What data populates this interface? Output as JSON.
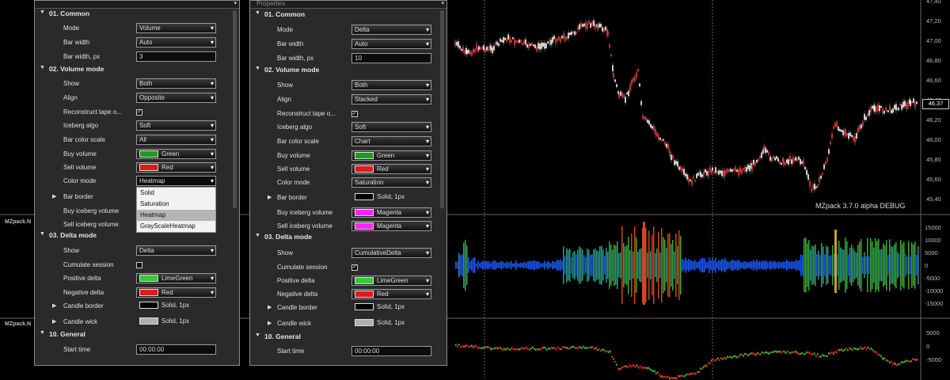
{
  "chart": {
    "price_ticks": [
      "47,40",
      "47,20",
      "47,00",
      "46,80",
      "46,60",
      "46,40",
      "46,20",
      "46,00",
      "45,80",
      "45,60",
      "45,40"
    ],
    "current_price": "46,37",
    "delta_ticks": [
      "15000",
      "10000",
      "5000",
      "0",
      "-5000",
      "-10000",
      "-15000"
    ],
    "cum_ticks": [
      "5000",
      "0",
      "-5000"
    ],
    "watermark": "MZpack 3.7.0 alpha DEBUG",
    "panel2_title": "MZpack.N",
    "panel3_title": "MZpack.N",
    "colors": {
      "up": "#ffffff",
      "down": "#ff3333",
      "volume_bar": "#1b5cff",
      "cum_up": "#33cc33",
      "cum_down": "#ff2222",
      "grid": "#444444"
    }
  },
  "left_panel": {
    "sections": {
      "common": "01. Common",
      "volume": "02. Volume mode",
      "delta": "03. Delta mode",
      "general": "10. General"
    },
    "rows": {
      "mode": {
        "label": "Mode",
        "value": "Volume"
      },
      "bar_width": {
        "label": "Bar width",
        "value": "Auto"
      },
      "bar_width_px": {
        "label": "Bar width, px",
        "value": "3"
      },
      "show": {
        "label": "Show",
        "value": "Both"
      },
      "align": {
        "label": "Align",
        "value": "Opposite"
      },
      "reconstruct": {
        "label": "Reconstruct tape o...",
        "value": "✓"
      },
      "iceberg_algo": {
        "label": "Iceberg algo",
        "value": "Soft"
      },
      "bar_color_scale": {
        "label": "Bar color scale",
        "value": "All"
      },
      "buy_volume": {
        "label": "Buy volume",
        "value": "Green"
      },
      "sell_volume": {
        "label": "Sell volume",
        "value": "Red"
      },
      "color_mode": {
        "label": "Color mode",
        "value": "Heatmap"
      },
      "bar_border": {
        "label": "Bar border"
      },
      "buy_iceberg": {
        "label": "Buy iceberg volume"
      },
      "sell_iceberg": {
        "label": "Sell iceberg volume"
      },
      "d_show": {
        "label": "Show",
        "value": "Delta"
      },
      "cumulate": {
        "label": "Cumulate session"
      },
      "pos_delta": {
        "label": "Positive delta",
        "value": "LimeGreen"
      },
      "neg_delta": {
        "label": "Negative delta",
        "value": "Red"
      },
      "candle_border": {
        "label": "Candle border",
        "value": "Solid, 1px"
      },
      "candle_wick": {
        "label": "Candle wick",
        "value": "Solid, 1px"
      },
      "start_time": {
        "label": "Start time",
        "value": "00:00:00"
      }
    },
    "dropdown_options": [
      "Solid",
      "Saturation",
      "Heatmap",
      "GrayScaleHeatmap"
    ],
    "dropdown_selected": "Heatmap"
  },
  "right_panel": {
    "header": "Properties",
    "sections": {
      "common": "01. Common",
      "volume": "02. Volume mode",
      "delta": "03. Delta mode",
      "general": "10. General"
    },
    "rows": {
      "mode": {
        "label": "Mode",
        "value": "Delta"
      },
      "bar_width": {
        "label": "Bar width",
        "value": "Auto"
      },
      "bar_width_px": {
        "label": "Bar width, px",
        "value": "10"
      },
      "show": {
        "label": "Show",
        "value": "Both"
      },
      "align": {
        "label": "Align",
        "value": "Stacked"
      },
      "reconstruct": {
        "label": "Reconstruct tape o...",
        "value": "✓"
      },
      "iceberg_algo": {
        "label": "Iceberg algo",
        "value": "Soft"
      },
      "bar_color_scale": {
        "label": "Bar color scale",
        "value": "Chart"
      },
      "buy_volume": {
        "label": "Buy volume",
        "value": "Green"
      },
      "sell_volume": {
        "label": "Sell volume",
        "value": "Red"
      },
      "color_mode": {
        "label": "Color mode",
        "value": "Saturation"
      },
      "bar_border": {
        "label": "Bar border",
        "value": "Solid, 1px"
      },
      "buy_iceberg": {
        "label": "Buy iceberg volume",
        "value": "Magenta"
      },
      "sell_iceberg": {
        "label": "Sell iceberg volume",
        "value": "Magenta"
      },
      "d_show": {
        "label": "Show",
        "value": "CumulativeDelta"
      },
      "cumulate": {
        "label": "Cumulate session",
        "value": "✓"
      },
      "pos_delta": {
        "label": "Positive delta",
        "value": "LimeGreen"
      },
      "neg_delta": {
        "label": "Negative delta",
        "value": "Red"
      },
      "candle_border": {
        "label": "Candle border",
        "value": "Solid, 1px"
      },
      "candle_wick": {
        "label": "Candle wick",
        "value": "Solid, 1px"
      },
      "start_time": {
        "label": "Start time",
        "value": "00:00:00"
      }
    }
  },
  "swatches": {
    "green": "#1a9e1a",
    "red": "#e01a1a",
    "limegreen": "#33cc33",
    "magenta": "#ff22ff",
    "white": "#000000",
    "silver": "#b0b0b0"
  }
}
